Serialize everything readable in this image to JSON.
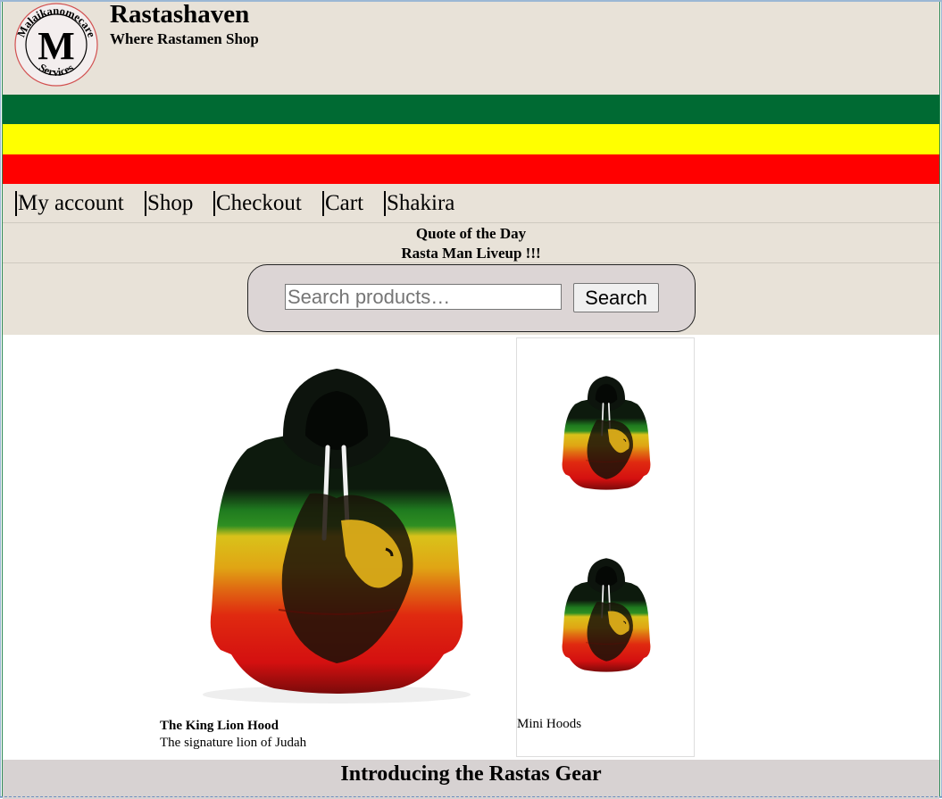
{
  "header": {
    "site_title": "Rastashaven",
    "tagline": "Where Rastamen Shop",
    "logo": {
      "letter": "M",
      "ring_top": "Malaikanomecare",
      "ring_bottom": "Services"
    }
  },
  "flag_colors": [
    "#006a33",
    "#ffff00",
    "#ff0000"
  ],
  "nav": {
    "items": [
      {
        "label": "My account"
      },
      {
        "label": "Shop"
      },
      {
        "label": "Checkout"
      },
      {
        "label": "Cart"
      },
      {
        "label": "Shakira"
      }
    ]
  },
  "quote": {
    "heading": "Quote of the Day",
    "text": "Rasta Man Liveup !!!"
  },
  "search": {
    "placeholder": "Search products…",
    "button_label": "Search"
  },
  "products": {
    "featured": {
      "name": "The King Lion Hood",
      "description": "The signature lion of Judah",
      "image_icon": "lion-hoodie-image"
    },
    "side": {
      "caption": "Mini Hoods",
      "image_icon": "lion-hoodie-thumbnail"
    }
  },
  "footer": {
    "title": "Introducing the Rastas Gear"
  }
}
